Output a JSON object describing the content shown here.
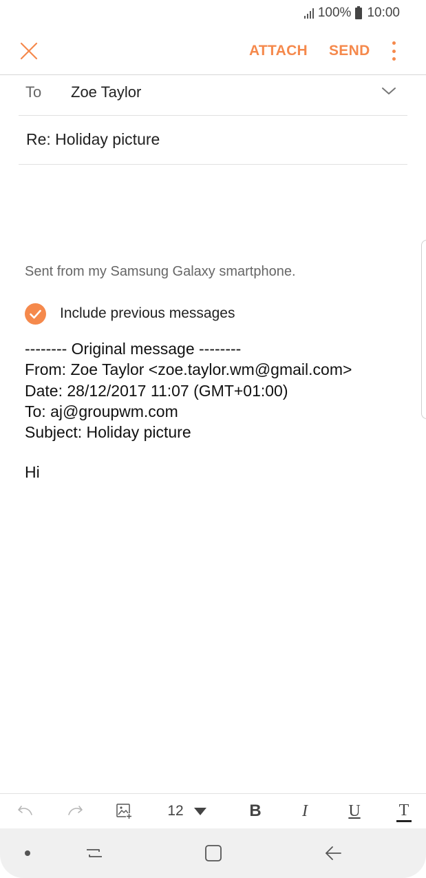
{
  "status_bar": {
    "battery": "100%",
    "time": "10:00"
  },
  "app_bar": {
    "close_icon": "close-icon",
    "attach_label": "ATTACH",
    "send_label": "SEND",
    "more_icon": "more-vert-icon",
    "accent_color": "#f5894c"
  },
  "header": {
    "to_label": "To",
    "to_value": "Zoe Taylor",
    "subject": "Re: Holiday picture"
  },
  "body": {
    "signature": "Sent from my Samsung Galaxy smartphone.",
    "include_previous_label": "Include previous messages",
    "include_previous_checked": true,
    "quoted_lines": [
      "-------- Original message --------",
      "From: Zoe Taylor <zoe.taylor.wm@gmail.com>",
      "Date: 28/12/2017 11:07 (GMT+01:00)",
      "To: aj@groupwm.com",
      "Subject: Holiday picture"
    ],
    "text": "Hi"
  },
  "format_toolbar": {
    "font_size": "12",
    "bold": "B",
    "italic": "I",
    "underline": "U",
    "text_style": "T",
    "icons": [
      "undo-icon",
      "redo-icon",
      "insert-image-icon",
      "font-size-dropdown-icon",
      "bold-icon",
      "italic-icon",
      "underline-icon",
      "text-color-icon"
    ]
  },
  "nav_bar": {
    "icons": [
      "dot-icon",
      "recent-apps-icon",
      "home-icon",
      "back-icon"
    ]
  }
}
